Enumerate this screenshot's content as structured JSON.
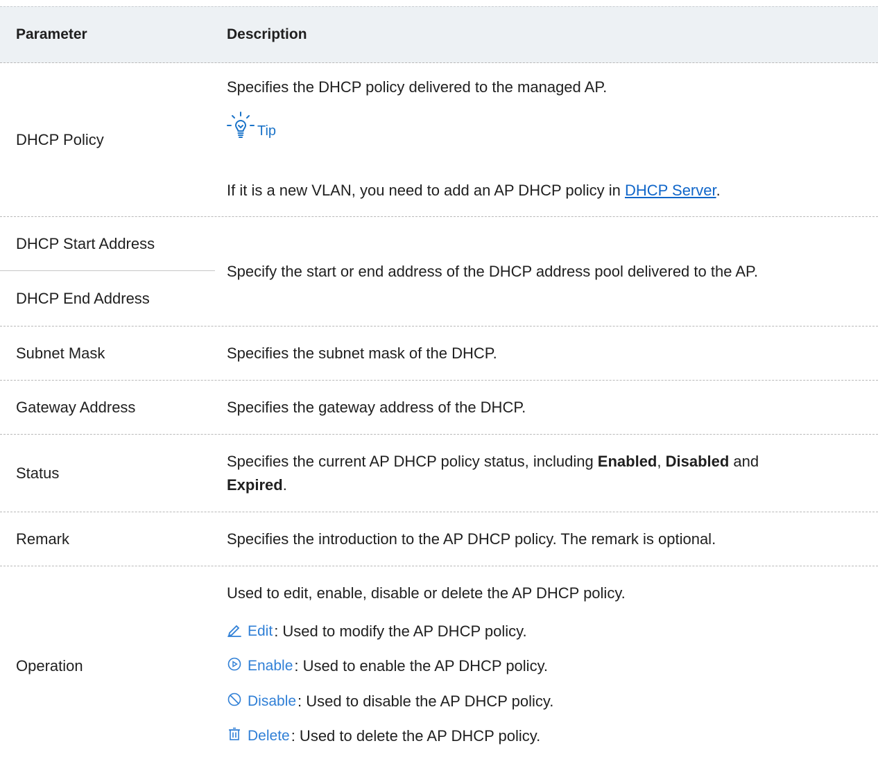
{
  "header": {
    "param": "Parameter",
    "desc": "Description"
  },
  "dhcp_policy": {
    "param": "DHCP Policy",
    "desc": "Specifies the DHCP policy delivered to the managed AP.",
    "tip_label": "Tip",
    "note_prefix": "If it is a new VLAN, you need to add an AP DHCP policy in ",
    "note_link": "DHCP Server",
    "note_suffix": "."
  },
  "dhcp_range": {
    "start_param": "DHCP Start Address",
    "end_param": "DHCP End Address",
    "desc": "Specify the start or end address of the DHCP address pool delivered to the AP."
  },
  "subnet": {
    "param": "Subnet Mask",
    "desc": "Specifies the subnet mask of the DHCP."
  },
  "gateway": {
    "param": "Gateway Address",
    "desc": "Specifies the gateway address of the DHCP."
  },
  "status": {
    "param": "Status",
    "desc_prefix": "Specifies the current AP DHCP policy status, including ",
    "enabled": "Enabled",
    "sep1": ", ",
    "disabled": "Disabled",
    "and": " and",
    "expired": "Expired",
    "end": "."
  },
  "remark": {
    "param": "Remark",
    "desc": "Specifies the introduction to the AP DHCP policy. The remark is optional."
  },
  "operation": {
    "param": "Operation",
    "desc": "Used to edit, enable, disable or delete the AP DHCP policy.",
    "edit_label": "Edit",
    "edit_desc": ": Used to modify the AP DHCP policy.",
    "enable_label": "Enable",
    "enable_desc": ": Used to enable the AP DHCP policy.",
    "disable_label": "Disable",
    "disable_desc": ": Used to disable the AP DHCP policy.",
    "delete_label": "Delete",
    "delete_desc": ": Used to delete the AP DHCP policy."
  }
}
